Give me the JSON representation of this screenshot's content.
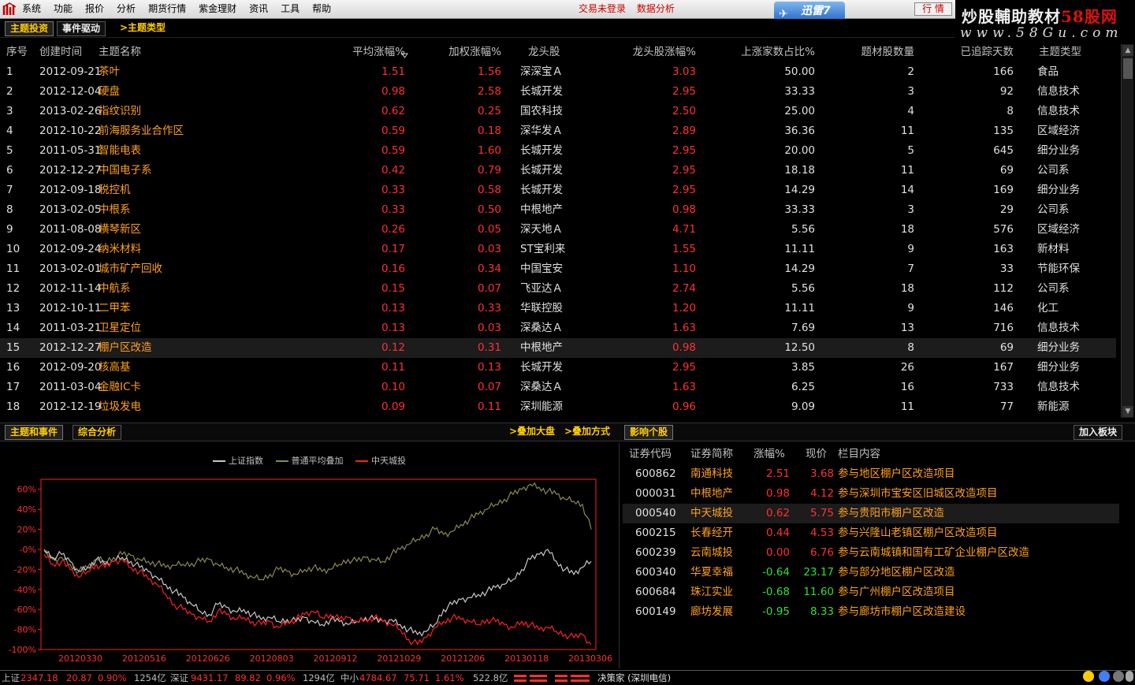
{
  "menubar": {
    "items": [
      "系统",
      "功能",
      "报价",
      "分析",
      "期货行情",
      "紫金理财",
      "资讯",
      "工具",
      "帮助"
    ],
    "status_links": [
      "交易未登录",
      "数据分析"
    ],
    "xunlei_label": "迅雷7",
    "hq_button": "行 情"
  },
  "brand": {
    "line1_a": "炒股輔助教材",
    "line1_b": "58股网",
    "line2": "www.58Gu.com"
  },
  "subtabs": {
    "tab1": "主题投资",
    "tab2": "事件驱动",
    "link": ">主题类型"
  },
  "themes": {
    "columns": [
      "序号",
      "创建时间",
      "主题名称",
      "平均涨幅%",
      "加权涨幅%",
      "龙头股",
      "龙头股涨幅%",
      "上涨家数占比%",
      "题材股数量",
      "已追踪天数",
      "主题类型"
    ],
    "rows": [
      [
        "1",
        "2012-09-21",
        "茶叶",
        "1.51",
        "1.56",
        "深深宝Ａ",
        "3.03",
        "50.00",
        "2",
        "166",
        "食品"
      ],
      [
        "2",
        "2012-12-04",
        "硬盘",
        "0.98",
        "2.58",
        "长城开发",
        "2.95",
        "33.33",
        "3",
        "92",
        "信息技术"
      ],
      [
        "3",
        "2013-02-26",
        "指纹识别",
        "0.62",
        "0.25",
        "国农科技",
        "2.50",
        "25.00",
        "4",
        "8",
        "信息技术"
      ],
      [
        "4",
        "2012-10-22",
        "前海服务业合作区",
        "0.59",
        "0.18",
        "深华发Ａ",
        "2.89",
        "36.36",
        "11",
        "135",
        "区域经济"
      ],
      [
        "5",
        "2011-05-31",
        "智能电表",
        "0.59",
        "1.60",
        "长城开发",
        "2.95",
        "20.00",
        "5",
        "645",
        "细分业务"
      ],
      [
        "6",
        "2012-12-27",
        "中国电子系",
        "0.42",
        "0.79",
        "长城开发",
        "2.95",
        "18.18",
        "11",
        "69",
        "公司系"
      ],
      [
        "7",
        "2012-09-18",
        "税控机",
        "0.33",
        "0.58",
        "长城开发",
        "2.95",
        "14.29",
        "14",
        "169",
        "细分业务"
      ],
      [
        "8",
        "2013-02-05",
        "中根系",
        "0.33",
        "0.50",
        "中根地产",
        "0.98",
        "33.33",
        "3",
        "29",
        "公司系"
      ],
      [
        "9",
        "2011-08-08",
        "横琴新区",
        "0.26",
        "0.05",
        "深天地Ａ",
        "4.71",
        "5.56",
        "18",
        "576",
        "区域经济"
      ],
      [
        "10",
        "2012-09-24",
        "纳米材料",
        "0.17",
        "0.03",
        "ST宝利来",
        "1.55",
        "11.11",
        "9",
        "163",
        "新材料"
      ],
      [
        "11",
        "2013-02-01",
        "城市矿产回收",
        "0.16",
        "0.34",
        "中国宝安",
        "1.10",
        "14.29",
        "7",
        "33",
        "节能环保"
      ],
      [
        "12",
        "2012-11-14",
        "中航系",
        "0.15",
        "0.07",
        "飞亚达Ａ",
        "2.74",
        "5.56",
        "18",
        "112",
        "公司系"
      ],
      [
        "13",
        "2012-10-11",
        "二甲苯",
        "0.13",
        "0.33",
        "华联控股",
        "1.20",
        "11.11",
        "9",
        "146",
        "化工"
      ],
      [
        "14",
        "2011-03-21",
        "卫星定位",
        "0.13",
        "0.03",
        "深桑达Ａ",
        "1.63",
        "7.69",
        "13",
        "716",
        "信息技术"
      ],
      [
        "15",
        "2012-12-27",
        "棚户区改造",
        "0.12",
        "0.31",
        "中根地产",
        "0.98",
        "12.50",
        "8",
        "69",
        "细分业务"
      ],
      [
        "16",
        "2012-09-20",
        "核高基",
        "0.11",
        "0.13",
        "长城开发",
        "2.95",
        "3.85",
        "26",
        "167",
        "细分业务"
      ],
      [
        "17",
        "2011-03-04",
        "金融IC卡",
        "0.10",
        "0.07",
        "深桑达Ａ",
        "1.63",
        "6.25",
        "16",
        "733",
        "信息技术"
      ],
      [
        "18",
        "2012-12-19",
        "垃圾发电",
        "0.09",
        "0.11",
        "深圳能源",
        "0.96",
        "9.09",
        "11",
        "77",
        "新能源"
      ]
    ],
    "selected_index": 14
  },
  "midbar": {
    "tab1": "主题和事件",
    "tab2": "综合分析",
    "link1": ">叠加大盘",
    "link2": ">叠加方式",
    "tab3": "影响个股",
    "button": "加入板块"
  },
  "chart_data": {
    "type": "line",
    "legend": [
      "上证指数",
      "普通平均叠加",
      "中天城投"
    ],
    "colors": {
      "sh": "#c8c8c8",
      "avg": "#8a8a50",
      "stock": "#ff2020",
      "frame": "#ff2020"
    },
    "x_ticks": [
      "20120330",
      "20120516",
      "20120626",
      "20120803",
      "20120912",
      "20121029",
      "20121206",
      "20130118",
      "20130306"
    ],
    "y_ticks": [
      "60%",
      "40%",
      "20%",
      "-0%",
      "-20%",
      "-40%",
      "-60%",
      "-80%",
      "-100%"
    ],
    "ylim": [
      -100,
      70
    ],
    "series": [
      {
        "name": "上证指数",
        "values": [
          0,
          -8,
          -5,
          -12,
          -22,
          -18,
          -10,
          -15,
          -12,
          -8,
          -12,
          -18,
          -22,
          -28,
          -35,
          -42,
          -48,
          -55,
          -62,
          -65,
          -55,
          -58,
          -62,
          -60,
          -65,
          -70,
          -68,
          -72,
          -70,
          -72,
          -68,
          -72,
          -75,
          -70,
          -72,
          -75,
          -72,
          -68,
          -70,
          -72,
          -70,
          -75,
          -80,
          -85,
          -82,
          -75,
          -60,
          -55,
          -50,
          -48,
          -45,
          -42,
          -38,
          -35,
          -30,
          -20,
          -10,
          -5,
          0,
          -12,
          -20,
          -25,
          -18,
          -12
        ]
      },
      {
        "name": "普通平均叠加",
        "values": [
          -2,
          -10,
          -8,
          -15,
          -22,
          -18,
          -10,
          -12,
          -8,
          -5,
          -6,
          -10,
          -12,
          -14,
          -18,
          -16,
          -15,
          -14,
          -12,
          -10,
          -15,
          -18,
          -20,
          -25,
          -28,
          -30,
          -25,
          -20,
          -22,
          -25,
          -20,
          -18,
          -22,
          -20,
          -15,
          -10,
          -12,
          -8,
          -10,
          -12,
          -5,
          0,
          5,
          10,
          15,
          20,
          15,
          18,
          25,
          30,
          35,
          40,
          45,
          50,
          55,
          60,
          65,
          62,
          58,
          55,
          50,
          48,
          45,
          20
        ]
      },
      {
        "name": "中天城投",
        "values": [
          -5,
          -15,
          -12,
          -20,
          -28,
          -22,
          -15,
          -18,
          -12,
          -10,
          -18,
          -22,
          -30,
          -35,
          -45,
          -55,
          -60,
          -65,
          -68,
          -72,
          -62,
          -65,
          -70,
          -68,
          -72,
          -75,
          -72,
          -78,
          -72,
          -70,
          -65,
          -62,
          -68,
          -65,
          -70,
          -68,
          -72,
          -70,
          -68,
          -72,
          -75,
          -80,
          -90,
          -95,
          -88,
          -78,
          -72,
          -68,
          -70,
          -72,
          -75,
          -70,
          -72,
          -75,
          -78,
          -72,
          -75,
          -80,
          -78,
          -82,
          -85,
          -88,
          -85,
          -95
        ]
      }
    ]
  },
  "stocks": {
    "columns": [
      "证券代码",
      "证券简称",
      "涨幅%",
      "现价",
      "栏目内容"
    ],
    "rows": [
      [
        "600862",
        "南通科技",
        "2.51",
        "3.68",
        "参与地区棚户区改造项目"
      ],
      [
        "000031",
        "中根地产",
        "0.98",
        "4.12",
        "参与深圳市宝安区旧城区改造项目"
      ],
      [
        "000540",
        "中天城投",
        "0.62",
        "5.75",
        "参与贵阳市棚户区改造"
      ],
      [
        "600215",
        "长春经开",
        "0.44",
        "4.53",
        "参与兴隆山老镇区棚户区改造项目"
      ],
      [
        "600239",
        "云南城投",
        "0.00",
        "6.76",
        "参与云南城镇和国有工矿企业棚户区改造"
      ],
      [
        "600340",
        "华夏幸福",
        "-0.64",
        "23.17",
        "参与部分地区棚户区改造"
      ],
      [
        "600684",
        "珠江实业",
        "-0.68",
        "11.60",
        "参与广州棚户区改造项目"
      ],
      [
        "600149",
        "廊坊发展",
        "-0.95",
        "8.33",
        "参与廊坊市棚户区改造建设"
      ]
    ],
    "selected_index": 2
  },
  "statusbar": {
    "sh_label": "上证",
    "sh_value": "2347.18",
    "sh_chg": "20.87",
    "sh_pct": "0.90%",
    "sh_vol": "1254亿",
    "sz_label": "深证",
    "sz_value": "9431.17",
    "sz_chg": "89.82",
    "sz_pct": "0.96%",
    "sz_vol": "1294亿",
    "zx_label": "中小",
    "zx_value": "4784.67",
    "zx_chg": "75.71",
    "zx_pct": "1.61%",
    "zx_vol": "522.8亿",
    "server": "决策家 (深圳电信)"
  }
}
